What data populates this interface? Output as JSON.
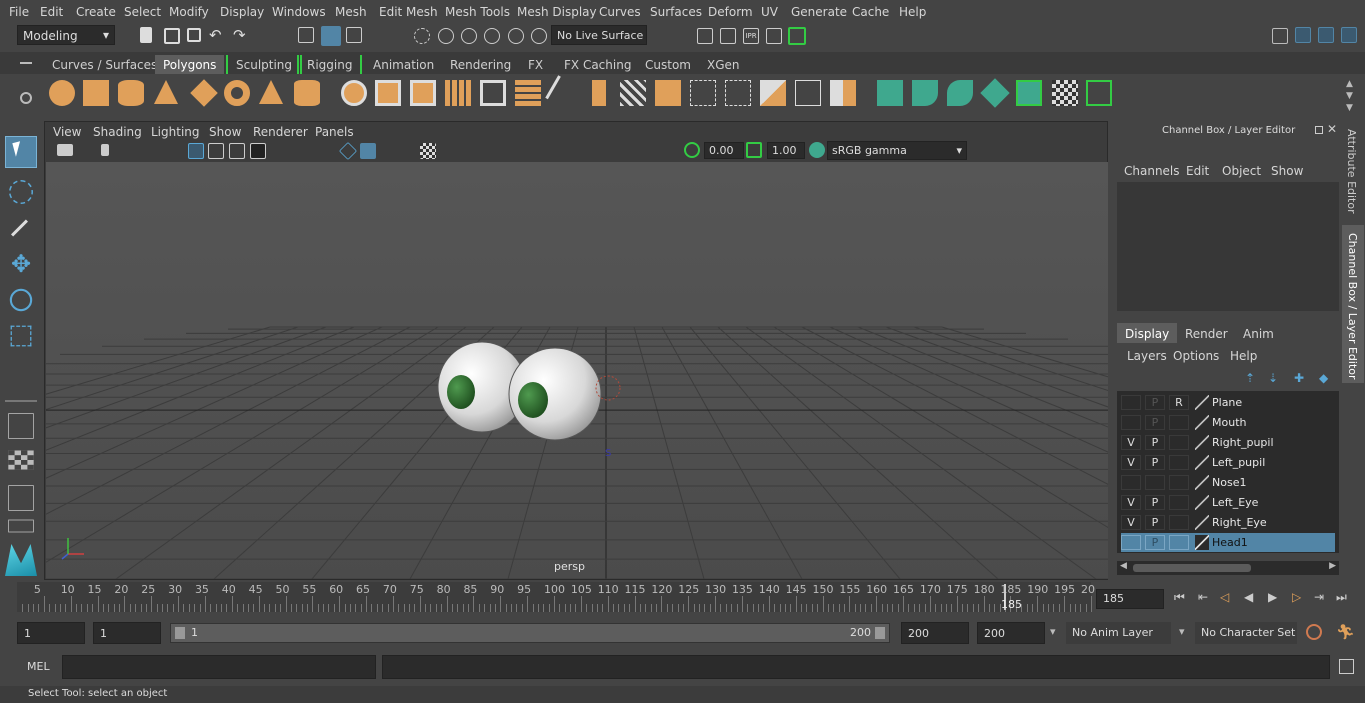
{
  "menubar": [
    "File",
    "Edit",
    "Create",
    "Select",
    "Modify",
    "Display",
    "Windows",
    "Mesh",
    "Edit Mesh",
    "Mesh Tools",
    "Mesh Display",
    "Curves",
    "Surfaces",
    "Deform",
    "UV",
    "Generate",
    "Cache",
    "Help"
  ],
  "status": {
    "mode": "Modeling",
    "live_surface": "No Live Surface"
  },
  "shelf_tabs": [
    "Curves / Surfaces",
    "Polygons",
    "Sculpting",
    "Rigging",
    "Animation",
    "Rendering",
    "FX",
    "FX Caching",
    "Custom",
    "XGen"
  ],
  "shelf_active": "Polygons",
  "panel_menu": [
    "View",
    "Shading",
    "Lighting",
    "Show",
    "Renderer",
    "Panels"
  ],
  "panel_toolbar": {
    "exposure": "0.00",
    "gamma": "1.00",
    "color_space": "sRGB gamma"
  },
  "viewport": {
    "camera_label": "persp",
    "selection_marker": "S"
  },
  "channel_box": {
    "title": "Channel Box / Layer Editor",
    "menu": [
      "Channels",
      "Edit",
      "Object",
      "Show"
    ],
    "layer_tabs": [
      "Display",
      "Render",
      "Anim"
    ],
    "active_layer_tab": "Display",
    "layer_menu": [
      "Layers",
      "Options",
      "Help"
    ],
    "layers": [
      {
        "name": "Plane",
        "v": "",
        "p": "P",
        "r": "R",
        "selected": false
      },
      {
        "name": "Mouth",
        "v": "",
        "p": "P",
        "r": "",
        "selected": false
      },
      {
        "name": "Right_pupil",
        "v": "V",
        "p": "P",
        "r": "",
        "selected": false
      },
      {
        "name": "Left_pupil",
        "v": "V",
        "p": "P",
        "r": "",
        "selected": false
      },
      {
        "name": "Nose1",
        "v": "",
        "p": "",
        "r": "",
        "selected": false
      },
      {
        "name": "Left_Eye",
        "v": "V",
        "p": "P",
        "r": "",
        "selected": false
      },
      {
        "name": "Right_Eye",
        "v": "V",
        "p": "P",
        "r": "",
        "selected": false
      },
      {
        "name": "Head1",
        "v": "",
        "p": "P",
        "r": "",
        "selected": true
      }
    ]
  },
  "side_tabs": {
    "attribute_editor": "Attribute Editor",
    "channel_box": "Channel Box / Layer Editor"
  },
  "timeline": {
    "ticks": [
      "5",
      "10",
      "15",
      "20",
      "25",
      "30",
      "35",
      "40",
      "45",
      "50",
      "55",
      "60",
      "65",
      "70",
      "75",
      "80",
      "85",
      "90",
      "95",
      "100",
      "105",
      "110",
      "115",
      "120",
      "125",
      "130",
      "135",
      "140",
      "145",
      "150",
      "155",
      "160",
      "165",
      "170",
      "175",
      "180",
      "185",
      "190",
      "195",
      "20"
    ],
    "current_frame": "185",
    "current_frame_field": "185"
  },
  "range": {
    "start": "1",
    "playback_start": "1",
    "slider_start": "1",
    "slider_end": "200",
    "playback_end": "200",
    "end": "200",
    "anim_layer": "No Anim Layer",
    "character_set": "No Character Set"
  },
  "command_line": {
    "lang": "MEL"
  },
  "help_line": "Select Tool: select an object",
  "colors": {
    "accent": "#5285a6",
    "orange_icon": "#e0a05a",
    "teal_icon": "#3fa88e",
    "green_highlight": "#33cc44"
  }
}
